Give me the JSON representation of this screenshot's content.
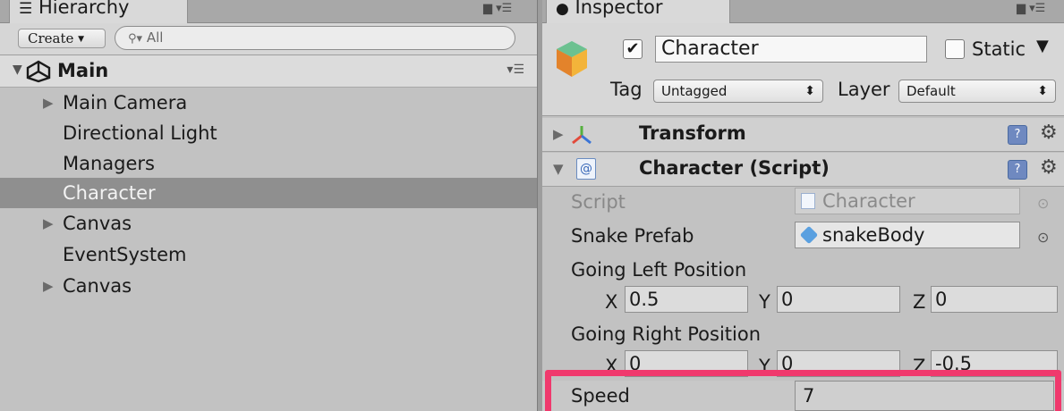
{
  "hierarchy": {
    "tab_title": "Hierarchy",
    "tab_icon": "list-icon",
    "create_label": "Create",
    "search_placeholder": "All",
    "scene": {
      "name": "Main",
      "icon": "unity-logo-icon"
    },
    "items": [
      {
        "label": "Main Camera",
        "expandable": true,
        "selected": false
      },
      {
        "label": "Directional Light",
        "expandable": false,
        "selected": false
      },
      {
        "label": "Managers",
        "expandable": false,
        "selected": false
      },
      {
        "label": "Character",
        "expandable": false,
        "selected": true
      },
      {
        "label": "Canvas",
        "expandable": true,
        "selected": false
      },
      {
        "label": "EventSystem",
        "expandable": false,
        "selected": false
      },
      {
        "label": "Canvas",
        "expandable": true,
        "selected": false
      }
    ]
  },
  "inspector": {
    "tab_title": "Inspector",
    "tab_icon": "info-icon",
    "object": {
      "active": true,
      "name": "Character",
      "static_label": "Static",
      "static_checked": false,
      "tag_label": "Tag",
      "tag_value": "Untagged",
      "layer_label": "Layer",
      "layer_value": "Default"
    },
    "components": [
      {
        "title": "Transform",
        "icon": "transform-axes-icon",
        "expanded": false
      },
      {
        "title": "Character (Script)",
        "icon": "csharp-script-icon",
        "expanded": true
      }
    ],
    "script_field": {
      "label": "Script",
      "value": "Character"
    },
    "snake_prefab": {
      "label": "Snake Prefab",
      "value": "snakeBody"
    },
    "going_left": {
      "label": "Going Left Position",
      "x_label": "X",
      "x": "0.5",
      "y_label": "Y",
      "y": "0",
      "z_label": "Z",
      "z": "0"
    },
    "going_right": {
      "label": "Going Right Position",
      "x_label": "X",
      "x": "0",
      "y_label": "Y",
      "y": "0",
      "z_label": "Z",
      "z": "-0.5"
    },
    "speed": {
      "label": "Speed",
      "value": "7"
    }
  },
  "colors": {
    "highlight": "#f0396d",
    "selection": "#8f8f8f",
    "panel": "#c2c2c2"
  }
}
